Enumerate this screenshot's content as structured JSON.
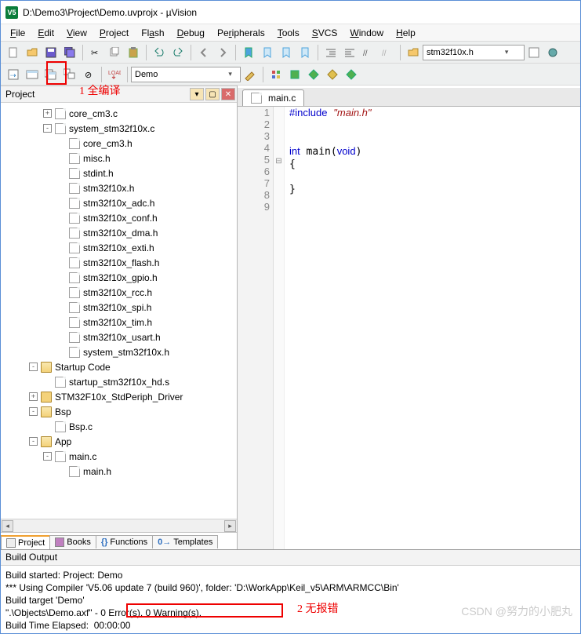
{
  "app": {
    "title": "D:\\Demo3\\Project\\Demo.uvprojx - µVision",
    "icon_label": "V5"
  },
  "menus": [
    "File",
    "Edit",
    "View",
    "Project",
    "Flash",
    "Debug",
    "Peripherals",
    "Tools",
    "SVCS",
    "Window",
    "Help"
  ],
  "toolbar1": {
    "combo_value": "stm32f10x.h"
  },
  "toolbar2": {
    "target_value": "Demo"
  },
  "annotations": {
    "a1": "1 全编译",
    "a2": "2 无报错"
  },
  "project_panel": {
    "title": "Project",
    "tree": [
      {
        "indent": 3,
        "expand": "+",
        "icon": "file",
        "label": "core_cm3.c"
      },
      {
        "indent": 3,
        "expand": "-",
        "icon": "file",
        "label": "system_stm32f10x.c"
      },
      {
        "indent": 4,
        "expand": "",
        "icon": "file",
        "label": "core_cm3.h"
      },
      {
        "indent": 4,
        "expand": "",
        "icon": "file",
        "label": "misc.h"
      },
      {
        "indent": 4,
        "expand": "",
        "icon": "file",
        "label": "stdint.h"
      },
      {
        "indent": 4,
        "expand": "",
        "icon": "file",
        "label": "stm32f10x.h"
      },
      {
        "indent": 4,
        "expand": "",
        "icon": "file",
        "label": "stm32f10x_adc.h"
      },
      {
        "indent": 4,
        "expand": "",
        "icon": "file",
        "label": "stm32f10x_conf.h"
      },
      {
        "indent": 4,
        "expand": "",
        "icon": "file",
        "label": "stm32f10x_dma.h"
      },
      {
        "indent": 4,
        "expand": "",
        "icon": "file",
        "label": "stm32f10x_exti.h"
      },
      {
        "indent": 4,
        "expand": "",
        "icon": "file",
        "label": "stm32f10x_flash.h"
      },
      {
        "indent": 4,
        "expand": "",
        "icon": "file",
        "label": "stm32f10x_gpio.h"
      },
      {
        "indent": 4,
        "expand": "",
        "icon": "file",
        "label": "stm32f10x_rcc.h"
      },
      {
        "indent": 4,
        "expand": "",
        "icon": "file",
        "label": "stm32f10x_spi.h"
      },
      {
        "indent": 4,
        "expand": "",
        "icon": "file",
        "label": "stm32f10x_tim.h"
      },
      {
        "indent": 4,
        "expand": "",
        "icon": "file",
        "label": "stm32f10x_usart.h"
      },
      {
        "indent": 4,
        "expand": "",
        "icon": "file",
        "label": "system_stm32f10x.h"
      },
      {
        "indent": 2,
        "expand": "-",
        "icon": "folderopen",
        "label": "Startup Code"
      },
      {
        "indent": 3,
        "expand": "",
        "icon": "file",
        "label": "startup_stm32f10x_hd.s"
      },
      {
        "indent": 2,
        "expand": "+",
        "icon": "folder",
        "label": "STM32F10x_StdPeriph_Driver"
      },
      {
        "indent": 2,
        "expand": "-",
        "icon": "folderopen",
        "label": "Bsp"
      },
      {
        "indent": 3,
        "expand": "",
        "icon": "file",
        "label": "Bsp.c"
      },
      {
        "indent": 2,
        "expand": "-",
        "icon": "folderopen",
        "label": "App"
      },
      {
        "indent": 3,
        "expand": "-",
        "icon": "file",
        "label": "main.c"
      },
      {
        "indent": 4,
        "expand": "",
        "icon": "file",
        "label": "main.h"
      }
    ],
    "bottom_tabs": [
      "Project",
      "Books",
      "Functions",
      "Templates"
    ]
  },
  "editor": {
    "tab_name": "main.c",
    "lines": [
      "1",
      "2",
      "3",
      "4",
      "5",
      "6",
      "7",
      "8",
      "9"
    ],
    "fold": [
      "",
      "",
      "",
      "",
      "⊟",
      "",
      "",
      "",
      ""
    ],
    "code": "#include \"main.h\"\n\n\nint main(void)\n{\n\n}\n\n"
  },
  "build": {
    "title": "Build Output",
    "text": "Build started: Project: Demo\n*** Using Compiler 'V5.06 update 7 (build 960)', folder: 'D:\\WorkApp\\Keil_v5\\ARM\\ARMCC\\Bin'\nBuild target 'Demo'\n\".\\Objects\\Demo.axf\" - 0 Error(s), 0 Warning(s).\nBuild Time Elapsed:  00:00:00"
  },
  "watermark": "CSDN @努力的小肥丸"
}
